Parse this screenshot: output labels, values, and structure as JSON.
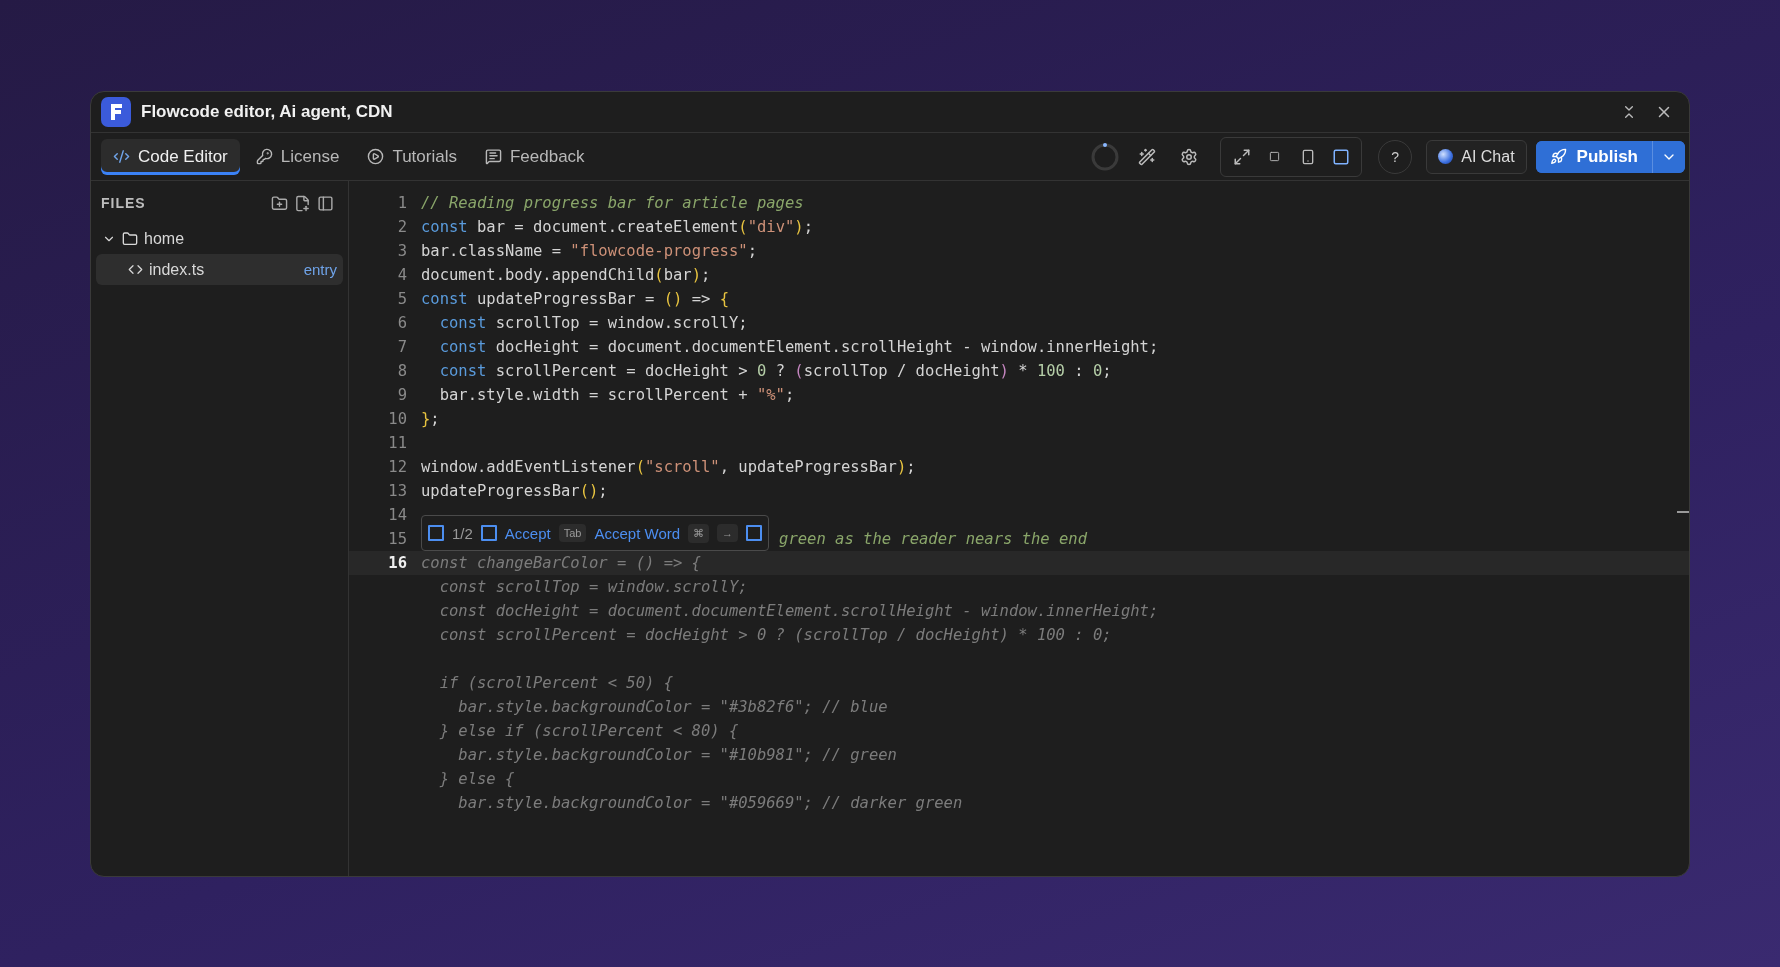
{
  "window": {
    "title": "Flowcode editor, Ai agent, CDN"
  },
  "tabs": [
    {
      "label": "Code Editor",
      "kind": "code",
      "selected": true
    },
    {
      "label": "License",
      "kind": "key",
      "selected": false
    },
    {
      "label": "Tutorials",
      "kind": "play",
      "selected": false
    },
    {
      "label": "Feedback",
      "kind": "message",
      "selected": false
    }
  ],
  "toolbar": {
    "views": [
      {
        "kind": "expand",
        "selected": false
      },
      {
        "kind": "small",
        "selected": false
      },
      {
        "kind": "phone",
        "selected": false
      },
      {
        "kind": "desktop",
        "selected": true
      }
    ],
    "help": "?",
    "ai_chat": "AI Chat",
    "publish": "Publish"
  },
  "sidebar": {
    "title": "FILES",
    "tree": [
      {
        "name": "home",
        "kind": "folder",
        "expanded": true,
        "selected": false,
        "children": [
          {
            "name": "index.ts",
            "kind": "file",
            "badge": "entry",
            "selected": true
          }
        ]
      }
    ]
  },
  "editor": {
    "suggestion": {
      "count": "1/2",
      "accept": "Accept",
      "accept_key": "Tab",
      "accept_word": "Accept Word",
      "word_keys": [
        "⌘",
        "→"
      ]
    },
    "lines": [
      {
        "number": "1",
        "current": false,
        "has_suggestion": false,
        "tokens": [
          {
            "kind": "comment",
            "text": "// Reading progress bar for article pages"
          }
        ]
      },
      {
        "number": "2",
        "current": false,
        "has_suggestion": false,
        "tokens": [
          {
            "kind": "keyword",
            "text": "const"
          },
          {
            "kind": "plain",
            "text": " bar = document.createElement"
          },
          {
            "kind": "bracket",
            "text": "("
          },
          {
            "kind": "string",
            "text": "\"div\""
          },
          {
            "kind": "bracket",
            "text": ")"
          },
          {
            "kind": "plain",
            "text": ";"
          }
        ]
      },
      {
        "number": "3",
        "current": false,
        "has_suggestion": false,
        "tokens": [
          {
            "kind": "plain",
            "text": "bar.className = "
          },
          {
            "kind": "string",
            "text": "\"flowcode-progress\""
          },
          {
            "kind": "plain",
            "text": ";"
          }
        ]
      },
      {
        "number": "4",
        "current": false,
        "has_suggestion": false,
        "tokens": [
          {
            "kind": "plain",
            "text": "document.body.appendChild"
          },
          {
            "kind": "bracket",
            "text": "("
          },
          {
            "kind": "plain",
            "text": "bar"
          },
          {
            "kind": "bracket",
            "text": ")"
          },
          {
            "kind": "plain",
            "text": ";"
          }
        ]
      },
      {
        "number": "5",
        "current": false,
        "has_suggestion": false,
        "tokens": [
          {
            "kind": "keyword",
            "text": "const"
          },
          {
            "kind": "plain",
            "text": " updateProgressBar = "
          },
          {
            "kind": "bracket",
            "text": "()"
          },
          {
            "kind": "plain",
            "text": " => "
          },
          {
            "kind": "bracket",
            "text": "{"
          }
        ]
      },
      {
        "number": "6",
        "current": false,
        "has_suggestion": false,
        "tokens": [
          {
            "kind": "keyword",
            "text": "  const"
          },
          {
            "kind": "plain",
            "text": " scrollTop = window.scrollY;"
          }
        ]
      },
      {
        "number": "7",
        "current": false,
        "has_suggestion": false,
        "tokens": [
          {
            "kind": "keyword",
            "text": "  const"
          },
          {
            "kind": "plain",
            "text": " docHeight = document.documentElement.scrollHeight - window.innerHeight;"
          }
        ]
      },
      {
        "number": "8",
        "current": false,
        "has_suggestion": false,
        "tokens": [
          {
            "kind": "keyword",
            "text": "  const"
          },
          {
            "kind": "plain",
            "text": " scrollPercent = docHeight > "
          },
          {
            "kind": "number",
            "text": "0"
          },
          {
            "kind": "plain",
            "text": " ? "
          },
          {
            "kind": "paren",
            "text": "("
          },
          {
            "kind": "plain",
            "text": "scrollTop / docHeight"
          },
          {
            "kind": "paren",
            "text": ")"
          },
          {
            "kind": "plain",
            "text": " * "
          },
          {
            "kind": "number",
            "text": "100"
          },
          {
            "kind": "plain",
            "text": " : "
          },
          {
            "kind": "number",
            "text": "0"
          },
          {
            "kind": "plain",
            "text": ";"
          }
        ]
      },
      {
        "number": "9",
        "current": false,
        "has_suggestion": false,
        "tokens": [
          {
            "kind": "plain",
            "text": "  bar.style.width = scrollPercent + "
          },
          {
            "kind": "string",
            "text": "\"%\""
          },
          {
            "kind": "plain",
            "text": ";"
          }
        ]
      },
      {
        "number": "10",
        "current": false,
        "has_suggestion": false,
        "tokens": [
          {
            "kind": "bracket",
            "text": "}"
          },
          {
            "kind": "plain",
            "text": ";"
          }
        ]
      },
      {
        "number": "11",
        "current": false,
        "has_suggestion": false
      },
      {
        "number": "12",
        "current": false,
        "has_suggestion": false,
        "tokens": [
          {
            "kind": "plain",
            "text": "window.addEventListener"
          },
          {
            "kind": "bracket",
            "text": "("
          },
          {
            "kind": "string",
            "text": "\"scroll\""
          },
          {
            "kind": "plain",
            "text": ", updateProgressBar"
          },
          {
            "kind": "bracket",
            "text": ")"
          },
          {
            "kind": "plain",
            "text": ";"
          }
        ]
      },
      {
        "number": "13",
        "current": false,
        "has_suggestion": false,
        "tokens": [
          {
            "kind": "plain",
            "text": "updateProgressBar"
          },
          {
            "kind": "bracket",
            "text": "()"
          },
          {
            "kind": "plain",
            "text": ";"
          }
        ]
      },
      {
        "number": "14",
        "current": false,
        "has_suggestion": false
      },
      {
        "number": "15",
        "current": false,
        "has_suggestion": true,
        "tokens": [
          {
            "kind": "ghost-comment",
            "text": "green as the reader nears the end"
          }
        ]
      },
      {
        "number": "16",
        "current": true,
        "has_suggestion": false,
        "tokens": [
          {
            "kind": "ghost",
            "text": "const changeBarColor = () => {"
          }
        ]
      }
    ],
    "ghost_blocks": [
      [
        {
          "tokens": [
            {
              "kind": "ghost",
              "text": "  const scrollTop = window.scrollY;"
            }
          ]
        },
        {
          "tokens": [
            {
              "kind": "ghost",
              "text": "  const docHeight = document.documentElement.scrollHeight - window.innerHeight;"
            }
          ]
        },
        {
          "tokens": [
            {
              "kind": "ghost",
              "text": "  const scrollPercent = docHeight > 0 ? (scrollTop / docHeight) * 100 : 0;"
            }
          ]
        }
      ],
      [
        {
          "tokens": [
            {
              "kind": "ghost",
              "text": "  if (scrollPercent < 50) {"
            }
          ]
        },
        {
          "tokens": [
            {
              "kind": "ghost",
              "text": "    bar.style.backgroundColor = \"#3b82f6\"; // blue"
            }
          ]
        },
        {
          "tokens": [
            {
              "kind": "ghost",
              "text": "  } else if (scrollPercent < 80) {"
            }
          ]
        },
        {
          "tokens": [
            {
              "kind": "ghost",
              "text": "    bar.style.backgroundColor = \"#10b981\"; // green"
            }
          ]
        },
        {
          "tokens": [
            {
              "kind": "ghost",
              "text": "  } else {"
            }
          ]
        },
        {
          "tokens": [
            {
              "kind": "ghost",
              "text": "    bar.style.backgroundColor = \"#059669\"; // darker green"
            }
          ]
        }
      ]
    ]
  }
}
